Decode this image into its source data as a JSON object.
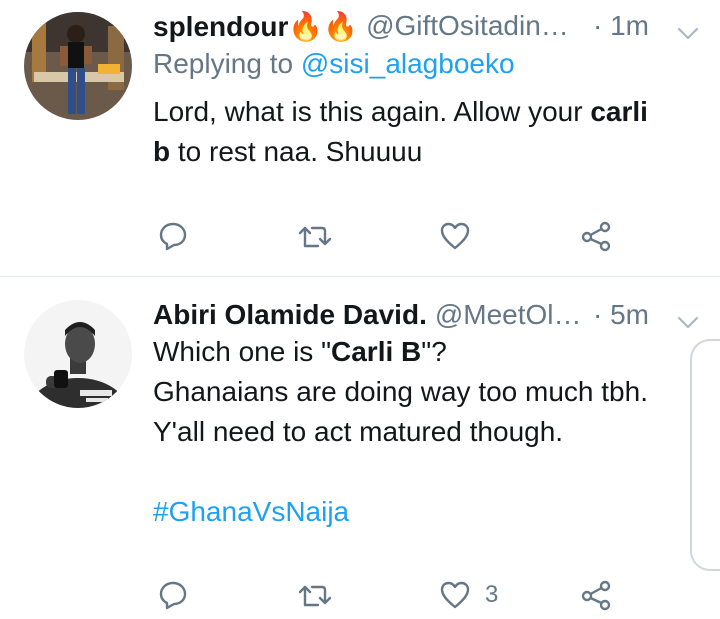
{
  "tweets": [
    {
      "name": "splendour🔥🔥",
      "handle": "@GiftOsitadin…",
      "time": "· 1m",
      "reply_prefix": "Replying to",
      "reply_to": "@sisi_alagboeko",
      "body_parts": [
        "Lord, what is this again.  Allow your ",
        "carli",
        " b",
        " to rest naa. Shuuuu"
      ],
      "actions": {
        "reply_count": "",
        "retweet_count": "",
        "like_count": ""
      }
    },
    {
      "name": "Abiri Olamide David.",
      "handle": "@MeetOl…",
      "time": "· 5m",
      "body_line1_pre": "Which one is \"",
      "body_line1_bold": "Carli B",
      "body_line1_post": "\"?",
      "body_line2": "Ghanaians are doing way too much tbh.",
      "body_line3": "Y'all need to act matured though.",
      "hashtag": "#GhanaVsNaija",
      "actions": {
        "reply_count": "",
        "retweet_count": "",
        "like_count": "3"
      }
    }
  ],
  "icons": {
    "reply": "reply-icon",
    "retweet": "retweet-icon",
    "like": "heart-icon",
    "share": "share-icon",
    "more": "chevron-down-icon"
  },
  "colors": {
    "link": "#1da1f2",
    "secondary": "#657786",
    "divider": "#e1e8ed"
  }
}
